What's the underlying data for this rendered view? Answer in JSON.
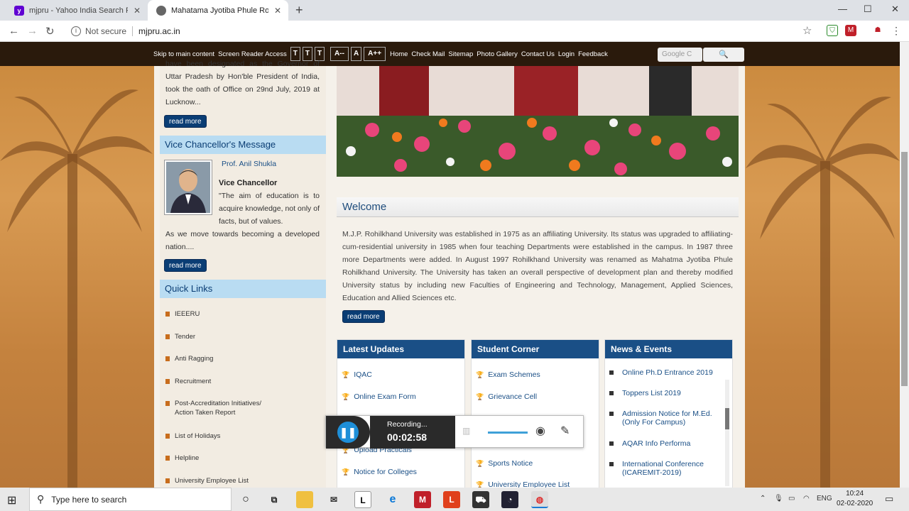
{
  "browser": {
    "tabs": [
      {
        "title": "mjpru - Yahoo India Search Results",
        "active": false
      },
      {
        "title": "Mahatama Jyotiba Phule Rohilkhand",
        "active": true
      }
    ],
    "new_tab": "+",
    "security": "Not secure",
    "url": "mjpru.ac.in"
  },
  "utility_bar": {
    "links": [
      "Skip to main content",
      "Screen Reader Access"
    ],
    "text_size": [
      "T",
      "T",
      "T"
    ],
    "zoom": [
      "A--",
      "A",
      "A++"
    ],
    "nav": [
      "Home",
      "Check Mail",
      "Sitemap",
      "Photo Gallery",
      "Contact Us",
      "Login",
      "Feedback"
    ],
    "search_placeholder": "Google C"
  },
  "left": {
    "governor_text": "have been designated as the Governor of Uttar Pradesh by Hon'ble President of India, took the oath of Office on 29nd July, 2019 at Lucknow...",
    "read_more": "read more",
    "vc_header": "Vice Chancellor's Message",
    "vc_name": "Prof. Anil Shukla",
    "vc_title": "Vice Chancellor",
    "vc_quote": "\"The aim of education is to acquire knowledge, not only of facts, but of values.",
    "vc_quote_cont": "As we move towards becoming a developed nation....",
    "quick_links_header": "Quick Links",
    "quick_links": [
      "IEEERU",
      "Tender",
      "Anti Ragging",
      "Recruitment",
      "Post-Accreditation Initiatives/ Action Taken Report",
      "List of Holidays",
      "Helpline",
      "University Employee List"
    ]
  },
  "welcome": {
    "heading": "Welcome",
    "text": "M.J.P. Rohilkhand University was established in 1975 as an affiliating University. Its status was upgraded to affiliating-cum-residential university in 1985 when four teaching Departments were established in the campus. In 1987 three more Departments were added. In August 1997 Rohilkhand University was renamed as Mahatma Jyotiba Phule Rohilkhand University. The University has taken an overall perspective of development plan and thereby modified University status by including new Faculties of Engineering and Technology, Management, Applied Sciences, Education and Allied Sciences etc.",
    "read_more": "read more"
  },
  "panels": {
    "latest_updates": {
      "title": "Latest Updates",
      "items": [
        "IQAC",
        "Online Exam Form",
        "Upload Practicals",
        "Notice for Colleges"
      ]
    },
    "student_corner": {
      "title": "Student Corner",
      "items": [
        "Exam Schemes",
        "Grievance Cell",
        "Sports Notice",
        "University Employee List"
      ]
    },
    "news_events": {
      "title": "News & Events",
      "items": [
        "Online Ph.D Entrance 2019",
        "Toppers List 2019",
        "Admission Notice for M.Ed. (Only For Campus)",
        "AQAR Info Performa",
        "International Conference (ICAREMIT-2019)"
      ]
    }
  },
  "recorder": {
    "status": "Recording...",
    "time": "00:02:58"
  },
  "taskbar": {
    "search_placeholder": "Type here to search",
    "lang": "ENG",
    "time": "10:24",
    "date": "02-02-2020"
  }
}
